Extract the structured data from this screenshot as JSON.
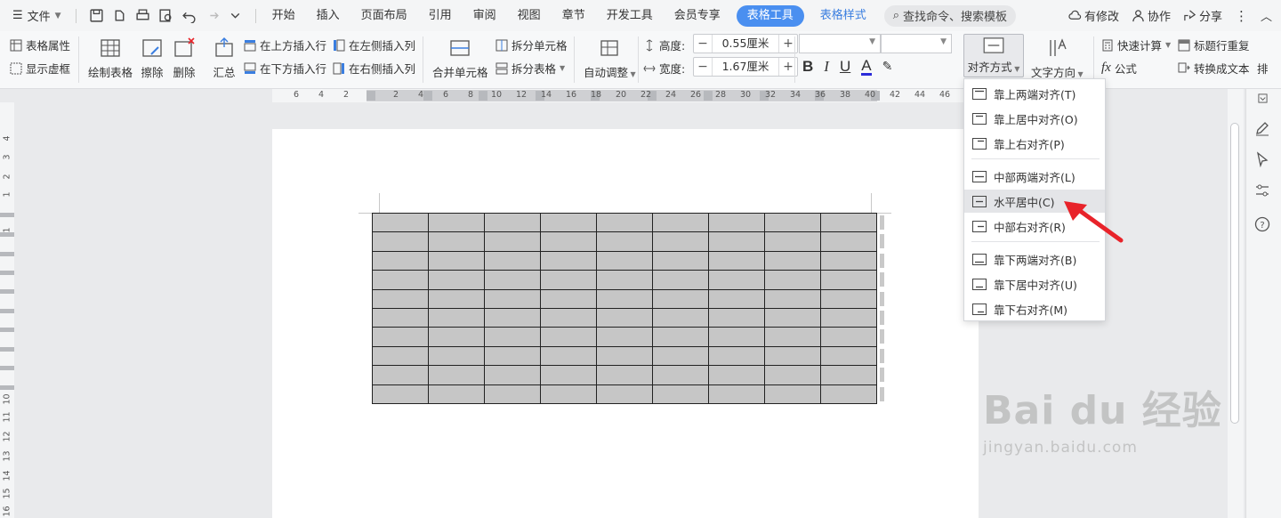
{
  "menubar": {
    "file_label": "文件",
    "tabs": [
      "开始",
      "插入",
      "页面布局",
      "引用",
      "审阅",
      "视图",
      "章节",
      "开发工具",
      "会员专享"
    ],
    "active_tab": "表格工具",
    "extra_tab": "表格样式",
    "search_label": "查找命令、搜索模板",
    "right": {
      "changes": "有修改",
      "collab": "协作",
      "share": "分享"
    }
  },
  "ribbon": {
    "table_props": "表格属性",
    "show_grid": "显示虚框",
    "draw_table": "绘制表格",
    "erase": "擦除",
    "delete": "删除",
    "summary": "汇总",
    "insert_above": "在上方插入行",
    "insert_below": "在下方插入行",
    "insert_left": "在左侧插入列",
    "insert_right": "在右侧插入列",
    "merge_cells": "合并单元格",
    "split_cells": "拆分单元格",
    "split_table": "拆分表格",
    "auto_fit": "自动调整",
    "height_label": "高度:",
    "height_value": "0.55厘米",
    "width_label": "宽度:",
    "width_value": "1.67厘米",
    "align_label": "对齐方式",
    "text_dir": "文字方向",
    "quick_calc": "快速计算",
    "repeat_header": "标题行重复",
    "formula": "公式",
    "to_text": "转换成文本",
    "sort_partial": "排"
  },
  "hruler": [
    "6",
    "4",
    "2",
    "2",
    "4",
    "6",
    "8",
    "10",
    "12",
    "14",
    "16",
    "18",
    "20",
    "22",
    "24",
    "26",
    "28",
    "30",
    "32",
    "34",
    "36",
    "38",
    "40",
    "42",
    "44",
    "46"
  ],
  "vruler": [
    "4",
    "3",
    "2",
    "1",
    "1",
    "10",
    "11",
    "12",
    "13",
    "14",
    "15",
    "16"
  ],
  "dropdown": {
    "items": [
      "靠上两端对齐(T)",
      "靠上居中对齐(O)",
      "靠上右对齐(P)",
      "中部两端对齐(L)",
      "水平居中(C)",
      "中部右对齐(R)",
      "靠下两端对齐(B)",
      "靠下居中对齐(U)",
      "靠下右对齐(M)"
    ],
    "hovered_index": 4
  },
  "table": {
    "rows": 10,
    "cols": 9
  },
  "watermark": {
    "logo": "Bai du 经验",
    "url": "jingyan.baidu.com"
  },
  "colors": {
    "accent": "#4a8ff0",
    "arrow": "#e8232a",
    "cell_fill": "#c6c6c6"
  }
}
